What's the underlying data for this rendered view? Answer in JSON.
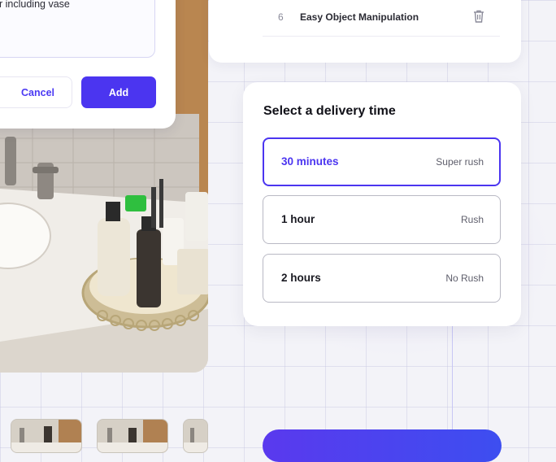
{
  "dialog": {
    "text": "r including vase",
    "cancel_label": "Cancel",
    "add_label": "Add"
  },
  "list": {
    "items": [
      {
        "number": "6",
        "label": "Easy Object Manipulation"
      }
    ]
  },
  "delivery": {
    "title": "Select a delivery time",
    "options": [
      {
        "label": "30 minutes",
        "sub": "Super rush",
        "selected": true
      },
      {
        "label": "1 hour",
        "sub": "Rush",
        "selected": false
      },
      {
        "label": "2 hours",
        "sub": "No Rush",
        "selected": false
      }
    ]
  },
  "colors": {
    "accent": "#4b35f0",
    "background": "#f3f3f8"
  }
}
